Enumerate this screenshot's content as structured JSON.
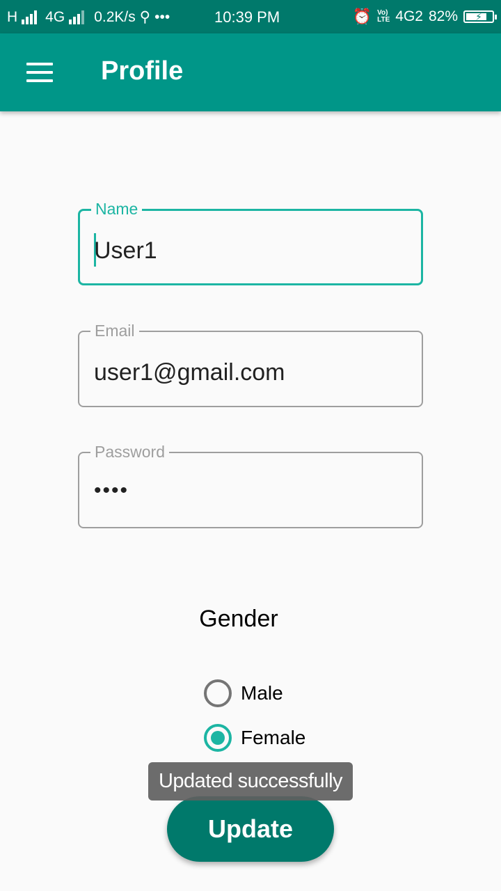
{
  "status_bar": {
    "network_h": "H",
    "network_4g": "4G",
    "speed": "0.2K/s",
    "usb_icon": "usb-icon",
    "more": "•••",
    "time": "10:39 PM",
    "volte_top": "Vo)",
    "volte_bottom": "LTE",
    "network_4g2": "4G2",
    "battery_percent": "82%",
    "battery_level": 0.82
  },
  "app_bar": {
    "title": "Profile",
    "menu_icon": "hamburger-menu-icon"
  },
  "form": {
    "name": {
      "label": "Name",
      "value": "User1"
    },
    "email": {
      "label": "Email",
      "value": "user1@gmail.com"
    },
    "password": {
      "label": "Password",
      "value": "••••"
    }
  },
  "gender": {
    "title": "Gender",
    "options": [
      {
        "label": "Male",
        "checked": false
      },
      {
        "label": "Female",
        "checked": true
      }
    ]
  },
  "toast": {
    "text": "Updated successfully"
  },
  "update_button": {
    "label": "Update"
  },
  "colors": {
    "status_bar": "#00796b",
    "app_bar": "#009688",
    "accent": "#1cb5a3",
    "button": "#00796b"
  }
}
